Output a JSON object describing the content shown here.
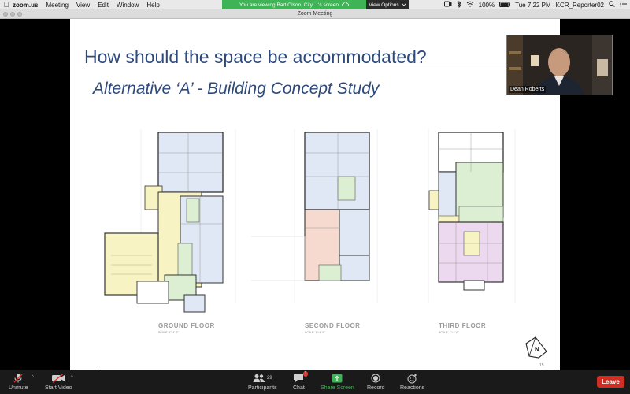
{
  "menubar": {
    "app_name": "zoom.us",
    "items": [
      "Meeting",
      "View",
      "Edit",
      "Window",
      "Help"
    ],
    "battery": "100%",
    "clock": "Tue 7:22 PM",
    "user": "KCR_Reporter02"
  },
  "share_banner": {
    "text": "You are viewing Bart Olson, City ...'s screen",
    "view_options": "View Options"
  },
  "window": {
    "title": "Zoom Meeting"
  },
  "slide": {
    "title": "How should the space be accommodated?",
    "subtitle": "Alternative ‘A’ - Building Concept Study",
    "floors": [
      {
        "label": "GROUND FLOOR",
        "scale": "SCALE: 1\"=1'-0\""
      },
      {
        "label": "SECOND FLOOR",
        "scale": "SCALE: 1\"=1'-0\""
      },
      {
        "label": "THIRD FLOOR",
        "scale": "SCALE: 1\"=1'-0\""
      }
    ],
    "north_label": "N",
    "page_number": "15"
  },
  "video": {
    "participant_name": "Dean Roberts"
  },
  "toolbar": {
    "unmute": "Unmute",
    "start_video": "Start Video",
    "participants": "Participants",
    "participant_count": "29",
    "chat": "Chat",
    "chat_badge": "1",
    "share_screen": "Share Screen",
    "record": "Record",
    "reactions": "Reactions",
    "leave": "Leave"
  },
  "colors": {
    "slide_title": "#2e4a7d",
    "share_green": "#3fb457",
    "leave_red": "#cf2e24",
    "room_blue": "#dfe8f4",
    "room_yellow": "#f8f3c2",
    "room_green": "#dcefd2",
    "room_pink": "#f6d9cf",
    "room_purple": "#ecd9ef"
  }
}
